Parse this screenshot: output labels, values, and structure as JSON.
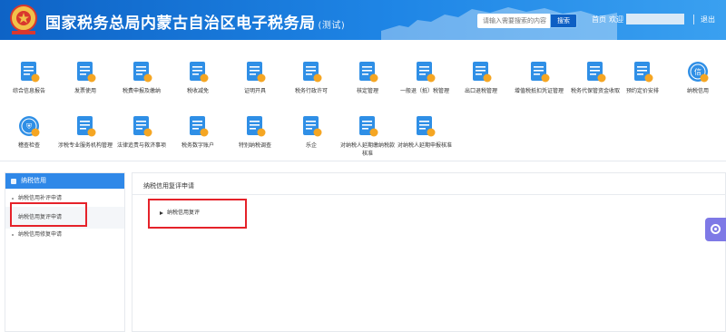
{
  "header": {
    "title": "国家税务总局内蒙古自治区电子税务局",
    "title_suffix": "(测试)",
    "search_placeholder": "请输入需要搜索的内容",
    "search_button": "搜索",
    "home": "首页",
    "welcome": "欢迎",
    "logout": "退出"
  },
  "services": [
    {
      "label": "综合信息报告",
      "icon": "report-icon",
      "color": "#2f8fe6"
    },
    {
      "label": "发票使用",
      "icon": "invoice-icon",
      "color": "#2f8fe6"
    },
    {
      "label": "税费申报及缴纳",
      "icon": "tax-declare-icon",
      "color": "#2f8fe6"
    },
    {
      "label": "税收减免",
      "icon": "tax-reduction-icon",
      "color": "#2f8fe6"
    },
    {
      "label": "证明开具",
      "icon": "certificate-icon",
      "color": "#2f8fe6"
    },
    {
      "label": "税务行政许可",
      "icon": "permit-icon",
      "color": "#2f8fe6"
    },
    {
      "label": "核定管理",
      "icon": "approval-icon",
      "color": "#2f8fe6"
    },
    {
      "label": "一般退（抵）税管理",
      "icon": "refund-icon",
      "color": "#2f8fe6"
    },
    {
      "label": "出口退税管理",
      "icon": "export-refund-icon",
      "color": "#2f8fe6"
    },
    {
      "label": "增值税抵扣凭证管理",
      "icon": "vat-voucher-icon",
      "color": "#2f8fe6"
    },
    {
      "label": "税务代保管资金收取",
      "icon": "custody-fund-icon",
      "color": "#2f8fe6"
    },
    {
      "label": "预约定价安排",
      "icon": "pricing-icon",
      "color": "#2f8fe6"
    },
    {
      "label": "纳税信用",
      "icon": "credit-icon",
      "color": "#2f8fe6"
    },
    {
      "label": "稽查检查",
      "icon": "shield-icon",
      "color": "#2f8fe6"
    },
    {
      "label": "涉税专业服务机构管理",
      "icon": "agency-icon",
      "color": "#2f8fe6"
    },
    {
      "label": "法律追责与救济事项",
      "icon": "law-icon",
      "color": "#2f8fe6"
    },
    {
      "label": "税务数字账户",
      "icon": "digital-account-icon",
      "color": "#2f8fe6"
    },
    {
      "label": "特别纳税调查",
      "icon": "investigation-icon",
      "color": "#2f8fe6"
    },
    {
      "label": "乐企",
      "icon": "leqi-icon",
      "color": "#2f8fe6"
    },
    {
      "label": "对纳税人延期缴纳税款核准",
      "icon": "deferred-payment-icon",
      "color": "#2f8fe6"
    },
    {
      "label": "对纳税人延期申报核准",
      "icon": "deferred-declare-icon",
      "color": "#2f8fe6"
    }
  ],
  "sidebar": {
    "header": "纳税信用",
    "items": [
      {
        "label": "纳税信用补评申请"
      },
      {
        "label": "纳税信用复评申请"
      },
      {
        "label": "纳税信用修复申请"
      }
    ]
  },
  "main": {
    "title": "纳税信用复评申请",
    "sub_item": "纳税信用复评"
  },
  "colors": {
    "header_blue": "#1f86e6",
    "highlight_red": "#e5222a",
    "accent_orange": "#f5a623",
    "float_purple": "#7e79e6"
  }
}
